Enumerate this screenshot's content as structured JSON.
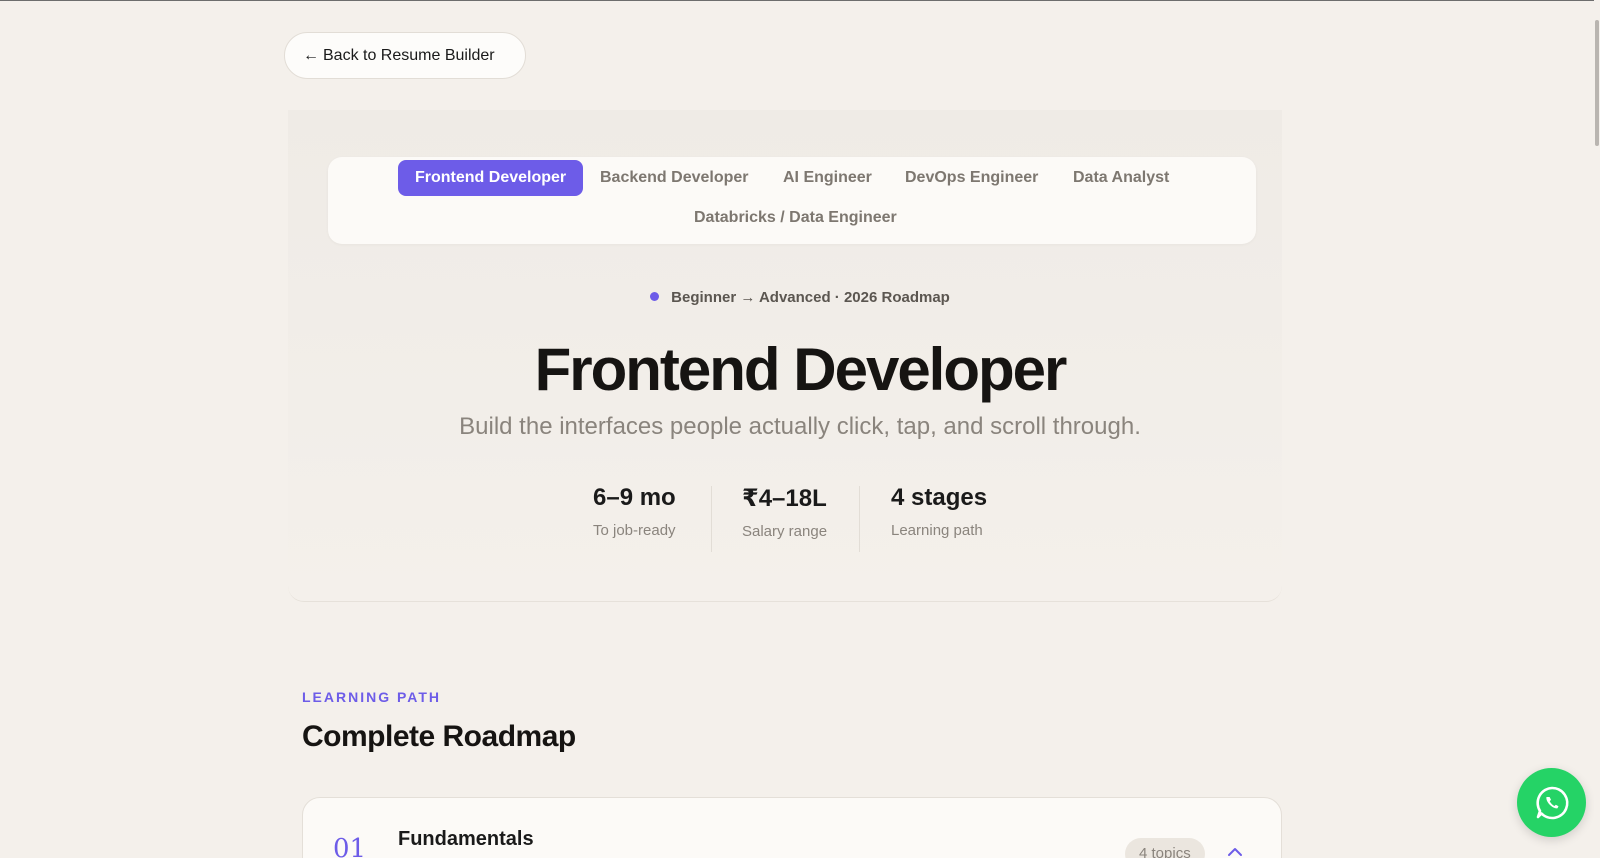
{
  "nav": {
    "back_label": "Back to Resume Builder",
    "back_arrow": "←"
  },
  "tabs": [
    {
      "label": "Frontend Developer",
      "active": true
    },
    {
      "label": "Backend Developer",
      "active": false
    },
    {
      "label": "AI Engineer",
      "active": false
    },
    {
      "label": "DevOps Engineer",
      "active": false
    },
    {
      "label": "Data Analyst",
      "active": false
    },
    {
      "label": "Databricks / Data Engineer",
      "active": false
    }
  ],
  "hero": {
    "badge": "Beginner → Advanced · 2026 Roadmap",
    "title": "Frontend Developer",
    "subtitle": "Build the interfaces people actually click, tap, and scroll through."
  },
  "stats": [
    {
      "value": "6–9 mo",
      "label": "To job-ready"
    },
    {
      "value": "₹4–18L",
      "label": "Salary range"
    },
    {
      "value": "4 stages",
      "label": "Learning path"
    }
  ],
  "section": {
    "eyebrow": "LEARNING PATH",
    "title": "Complete Roadmap"
  },
  "stages": [
    {
      "number": "01",
      "name": "Fundamentals",
      "topics": "4 topics",
      "expanded": true
    }
  ],
  "colors": {
    "accent": "#6d5ce8",
    "background": "#f4f0eb",
    "whatsapp": "#25d366"
  },
  "icons": {
    "back": "arrow-left-icon",
    "chevron": "chevron-up-icon",
    "chat": "whatsapp-icon"
  }
}
